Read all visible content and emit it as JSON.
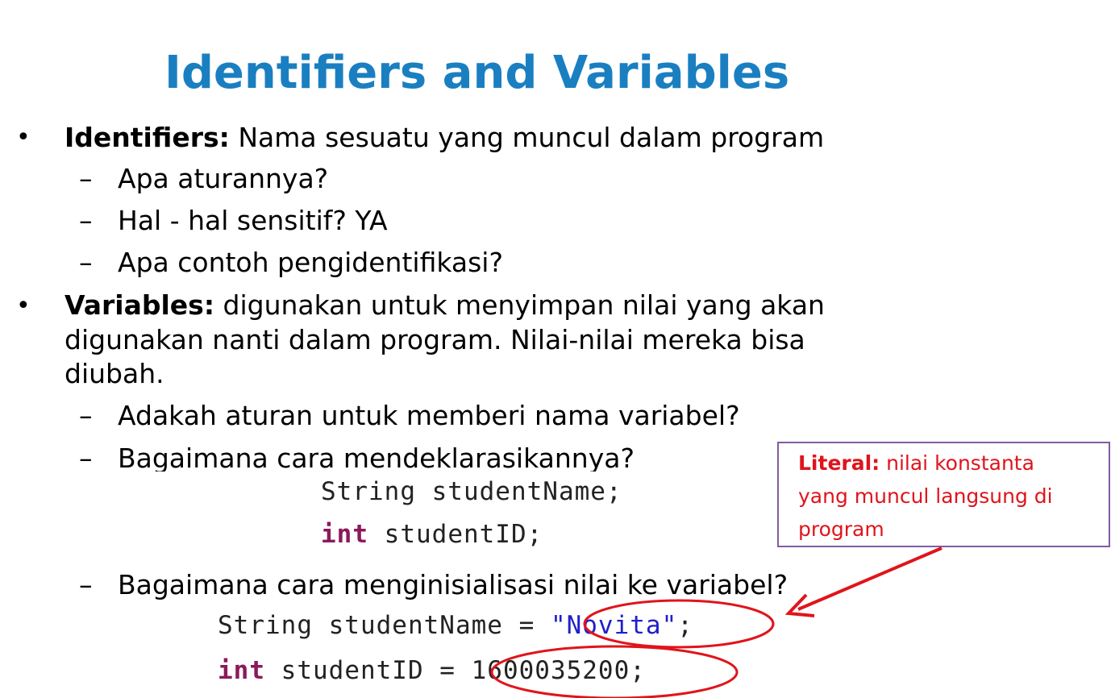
{
  "title": "Identifiers and Variables",
  "bullet1": {
    "term": "Identifiers:",
    "text": " Nama sesuatu yang muncul dalam program",
    "subs": [
      "Apa aturannya?",
      "Hal - hal sensitif? YA",
      "Apa contoh pengidentifikasi?"
    ]
  },
  "bullet2": {
    "term": "Variables:",
    "lines": [
      "  digunakan untuk menyimpan nilai yang akan",
      "digunakan nanti dalam program. Nilai-nilai mereka bisa",
      "diubah."
    ],
    "subs": [
      "Adakah aturan untuk memberi nama variabel?",
      "Bagaimana cara mendeklarasikannya?",
      "Bagaimana cara menginisialisasi nilai ke variabel?"
    ]
  },
  "bullet_glyph": "•",
  "dash_glyph": "–",
  "code_declare": {
    "line1": "String studentName;",
    "line2_kw": "int",
    "line2_rest": " studentID;"
  },
  "code_init": {
    "line1_a": "String studentName = ",
    "line1_str": "\"Novita\"",
    "line1_end": ";",
    "line2_kw": "int",
    "line2_rest": " studentID = 1600035200;"
  },
  "callout": {
    "term": "Literal:",
    "line1": " nilai konstanta",
    "line2": "yang muncul langsung di",
    "line3": "program"
  },
  "colors": {
    "title": "#1a7fc1",
    "callout_text": "#e0141b",
    "callout_border": "#7e5ea2",
    "highlight": "#e0141b",
    "keyword": "#8b1a5a",
    "string": "#2020c8"
  }
}
